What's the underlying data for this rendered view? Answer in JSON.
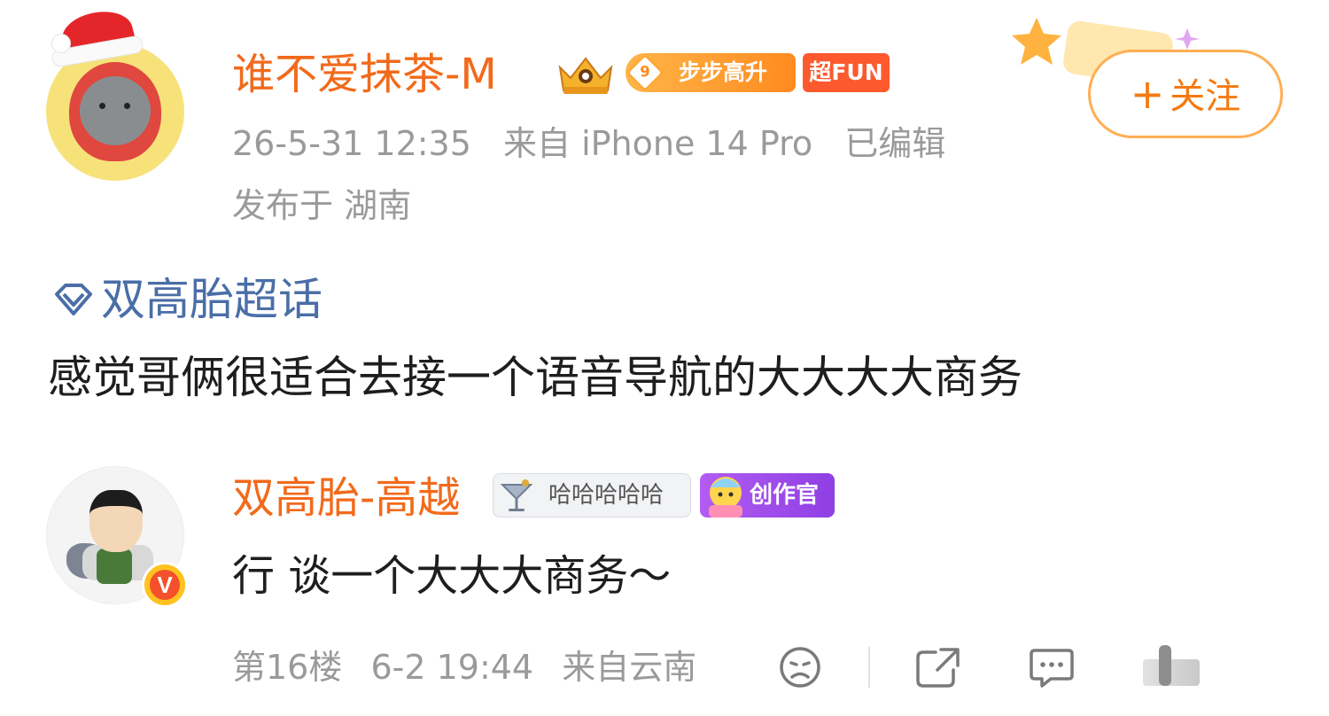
{
  "post": {
    "author": {
      "name": "谁不爱抹茶-M",
      "level_number": "9",
      "level_label": "步步高升",
      "fun_badge": "超FUN"
    },
    "meta": {
      "time": "26-5-31 12:35",
      "source": "来自 iPhone 14 Pro",
      "edited": "已编辑",
      "location": "发布于 湖南"
    },
    "follow_button": "关注",
    "follow_plus": "+",
    "topic": "双高胎超话",
    "text": "感觉哥俩很适合去接一个语音导航的大大大大商务"
  },
  "reply": {
    "author": {
      "name": "双高胎-高越",
      "cocktail_badge": "哈哈哈哈哈",
      "creator_badge": "创作官",
      "verified_label": "V"
    },
    "text": "行 谈一个大大大商务～",
    "meta": {
      "floor": "第16楼",
      "time": "6-2 19:44",
      "source": "来自云南"
    }
  },
  "colors": {
    "username": "#f26a1b",
    "topic": "#4a6ea7",
    "meta": "#9a9a9a",
    "follow_border": "#ffae52",
    "creator_badge": "#9b45ea"
  },
  "icons": [
    "santa-hat-icon",
    "crown-icon",
    "diamond-topic-icon",
    "cocktail-icon",
    "dislike-face-icon",
    "share-icon",
    "comment-icon",
    "like-icon"
  ]
}
